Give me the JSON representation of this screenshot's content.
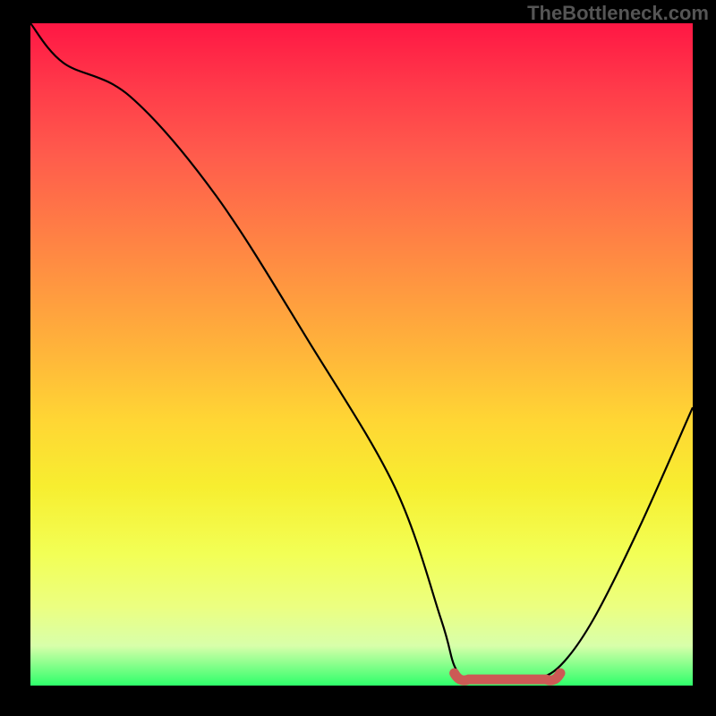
{
  "watermark": "TheBottleneck.com",
  "chart_data": {
    "type": "line",
    "title": "",
    "xlabel": "",
    "ylabel": "",
    "xlim": [
      0,
      100
    ],
    "ylim": [
      0,
      100
    ],
    "series": [
      {
        "name": "bottleneck-curve",
        "x": [
          0,
          5,
          15,
          28,
          42,
          55,
          62,
          64,
          66,
          70,
          76,
          80,
          85,
          92,
          100
        ],
        "values": [
          100,
          94,
          89,
          74,
          52,
          30,
          10,
          3,
          1,
          1,
          1,
          3,
          10,
          24,
          42
        ]
      }
    ],
    "valley_marker": {
      "name": "optimal-range",
      "x_start": 64,
      "x_end": 80,
      "color": "#cc5a55"
    },
    "background_gradient": {
      "top": "#ff1744",
      "mid": "#ffd634",
      "bottom": "#2eff6a",
      "meaning": "red=high bottleneck, green=low bottleneck"
    }
  }
}
